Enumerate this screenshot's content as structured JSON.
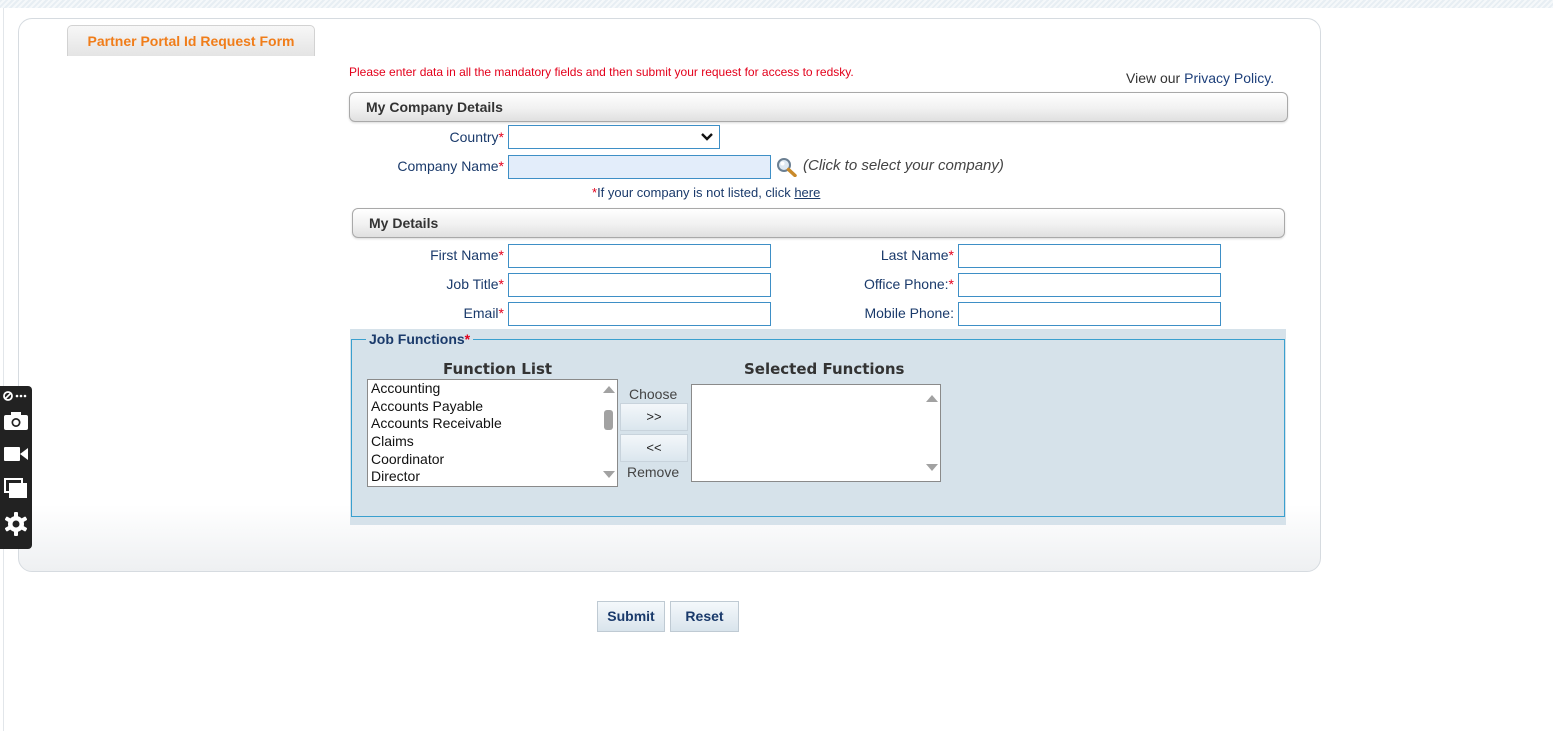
{
  "form": {
    "tab_title": "Partner Portal Id Request Form",
    "notice": "Please enter data in all the mandatory fields and then submit your request for access to redsky.",
    "privacy_prefix": "View our",
    "privacy_link": "Privacy Policy."
  },
  "company_section": {
    "title": "My Company Details",
    "country_label": "Country",
    "country_value": "",
    "company_name_label": "Company Name",
    "company_name_value": "",
    "company_hint": "(Click to select your company)",
    "not_listed_text": "If your company is not listed, click",
    "not_listed_link": "here"
  },
  "details_section": {
    "title": "My Details",
    "first_name_label": "First Name",
    "last_name_label": "Last Name",
    "job_title_label": "Job Title",
    "office_phone_label": "Office Phone:",
    "email_label": "Email",
    "mobile_phone_label": "Mobile Phone:"
  },
  "required_mark": "*",
  "job_functions": {
    "title": "Job Functions",
    "function_list_header": "Function List",
    "selected_header": "Selected Functions",
    "function_list": [
      "Accounting",
      "Accounts Payable",
      "Accounts Receivable",
      "Claims",
      "Coordinator",
      "Director"
    ],
    "selected": [],
    "choose_label": "Choose",
    "remove_label": "Remove",
    "add_button": ">>",
    "remove_button": "<<"
  },
  "actions": {
    "submit": "Submit",
    "reset": "Reset"
  },
  "colors": {
    "accent_orange": "#f07d1a",
    "required_red": "#e3001b",
    "label_blue": "#1a3a6b",
    "field_border": "#3e8fc6",
    "fieldset_bg": "#d6e2ea"
  },
  "sidebar_tools": [
    "extension-icon",
    "camera-icon",
    "video-icon",
    "windows-icon",
    "gear-icon"
  ]
}
